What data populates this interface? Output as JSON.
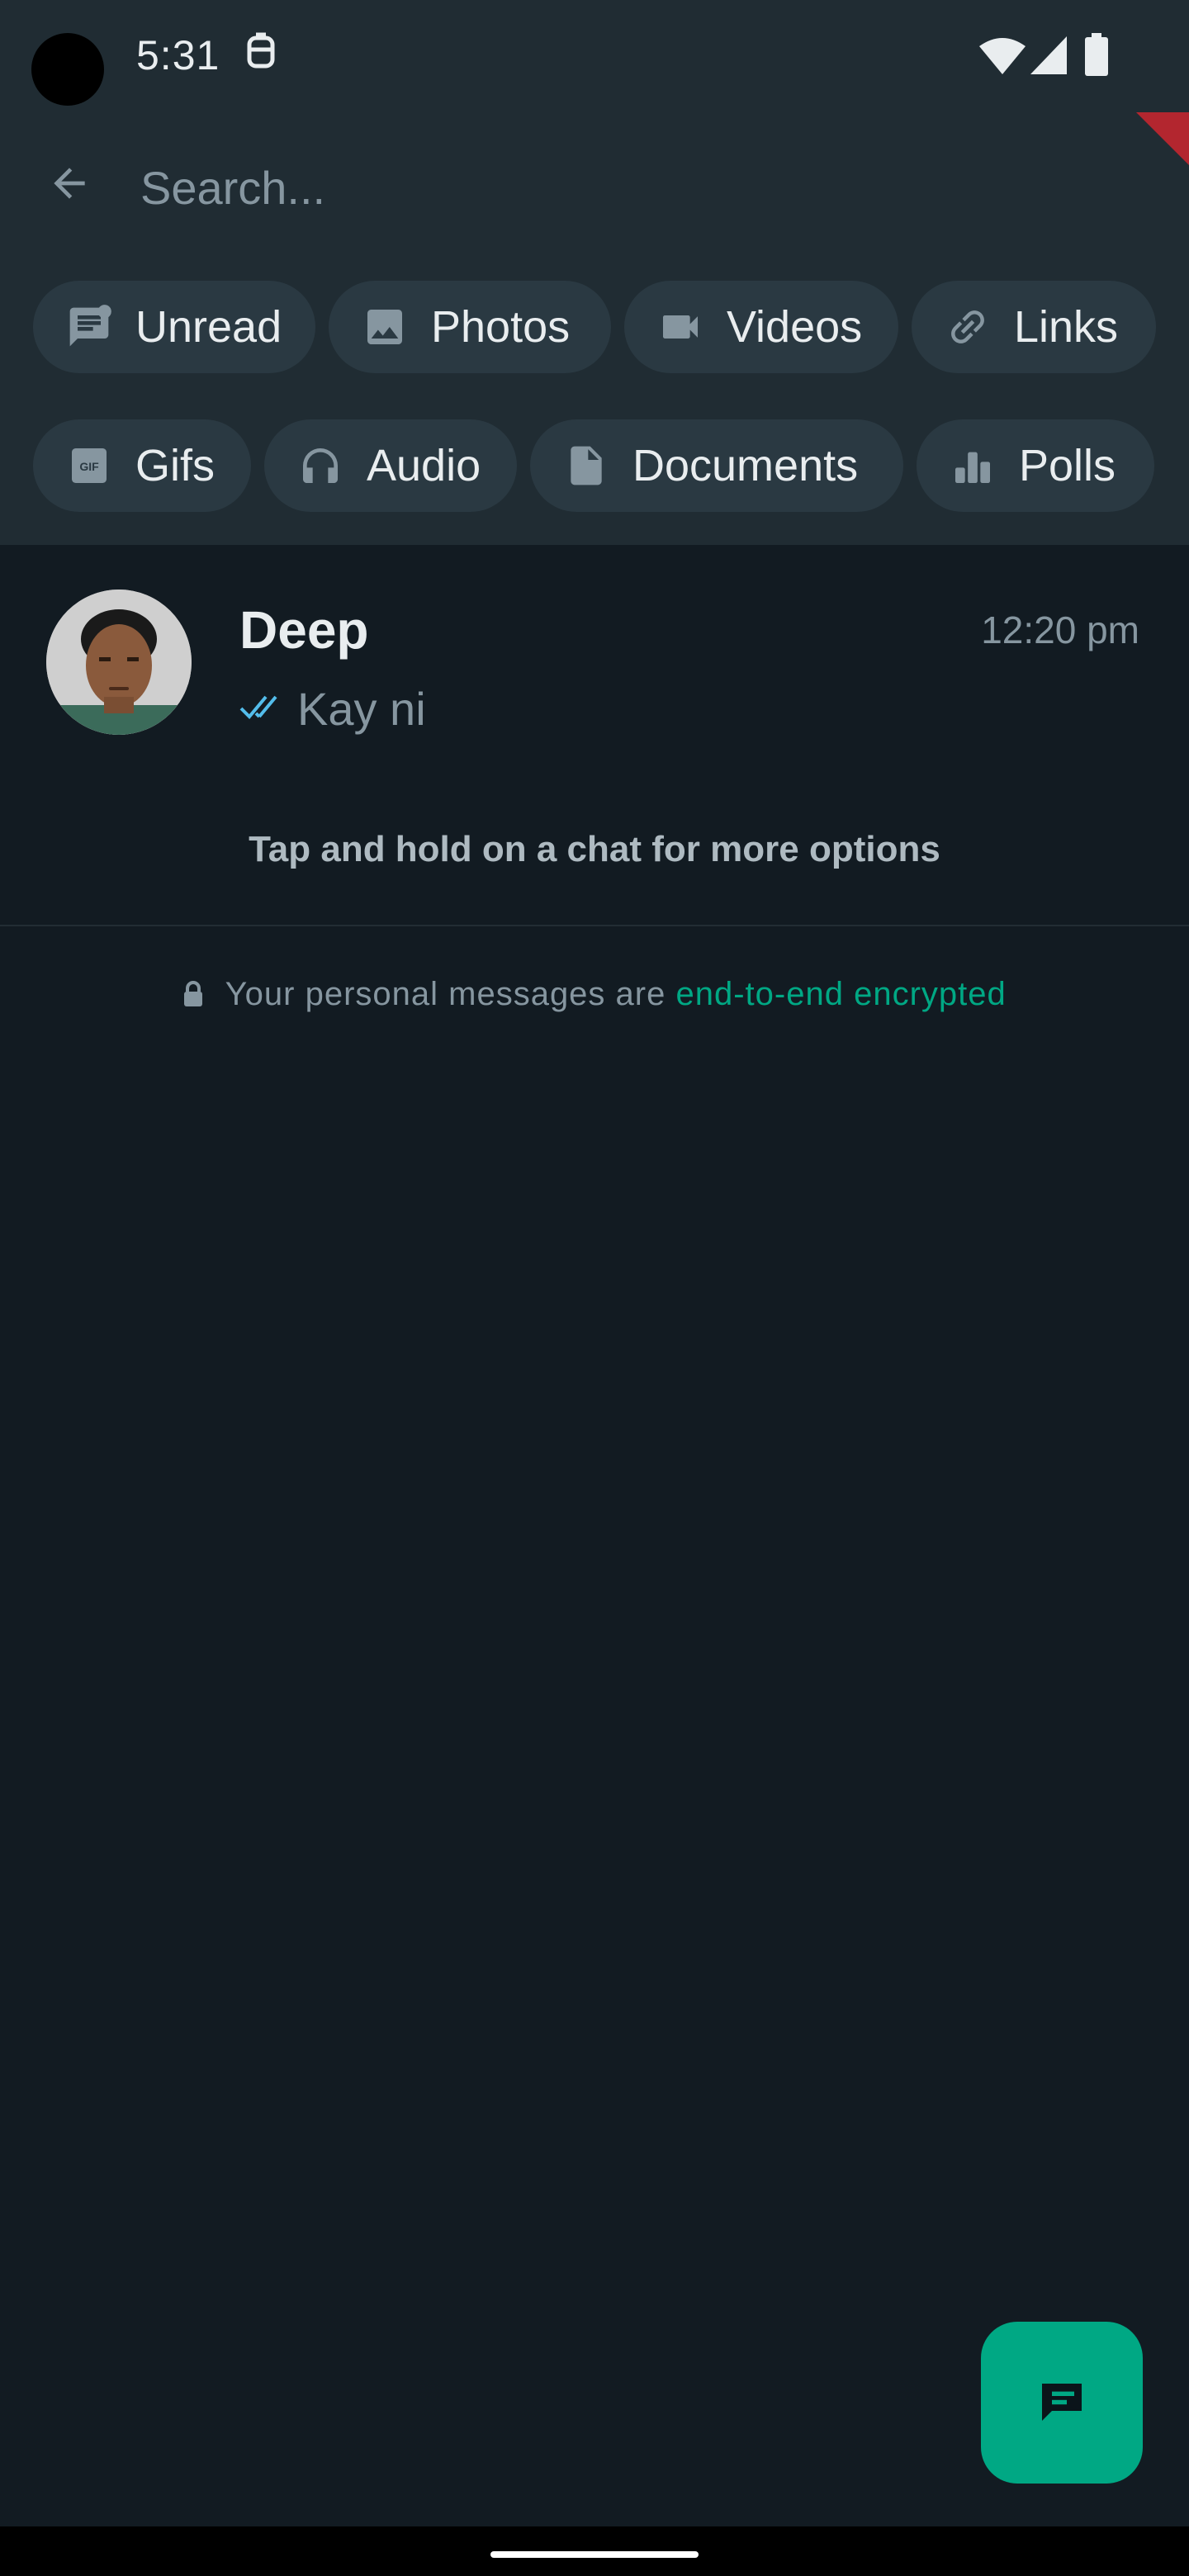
{
  "status_bar": {
    "time": "5:31"
  },
  "search": {
    "placeholder": "Search..."
  },
  "filters": {
    "row1": [
      {
        "label": "Unread",
        "icon": "unread-icon"
      },
      {
        "label": "Photos",
        "icon": "photo-icon"
      },
      {
        "label": "Videos",
        "icon": "video-icon"
      },
      {
        "label": "Links",
        "icon": "link-icon"
      }
    ],
    "row2": [
      {
        "label": "Gifs",
        "icon": "gif-icon"
      },
      {
        "label": "Audio",
        "icon": "headphones-icon"
      },
      {
        "label": "Documents",
        "icon": "document-icon"
      },
      {
        "label": "Polls",
        "icon": "poll-icon"
      }
    ],
    "gif_icon_text": "GIF"
  },
  "chats": [
    {
      "name": "Deep",
      "preview": "Kay ni",
      "time": "12:20 pm",
      "read": true
    }
  ],
  "tip": "Tap and hold on a chat for more options",
  "encryption": {
    "text": "Your personal messages are",
    "link": "end-to-end encrypted"
  },
  "colors": {
    "accent": "#00a884",
    "header_bg": "#202c33",
    "page_bg": "#121b22",
    "chip_bg": "#2a3942",
    "read_tick": "#53bdeb"
  }
}
